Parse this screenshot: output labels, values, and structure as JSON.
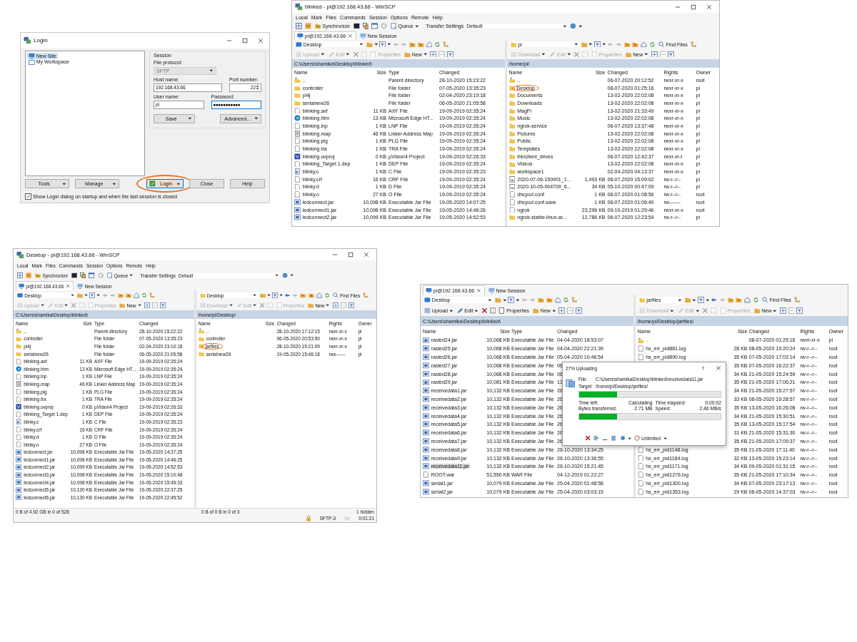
{
  "login_dialog": {
    "title": "Login",
    "sites": [
      {
        "label": "New Site",
        "kind": "site",
        "selected": true
      },
      {
        "label": "My Workspace",
        "kind": "workspace",
        "selected": false
      }
    ],
    "session": {
      "group_label": "Session",
      "protocol_label": "File protocol:",
      "protocol": "SFTP",
      "host_label": "Host name:",
      "host": "192.168.43.66",
      "port_label": "Port number:",
      "port": "22",
      "user_label": "User name:",
      "user": "pi",
      "password_label": "Password:",
      "password": "●●●●●●●●●●●"
    },
    "save": "Save",
    "advanced": "Advanced...",
    "tools": "Tools",
    "manage": "Manage",
    "login": {
      "label": "Login",
      "circled": true
    },
    "close": "Close",
    "help": "Help",
    "remember": {
      "label": "Show Login dialog on startup and when the last session is closed",
      "checked": true
    }
  },
  "windows": [
    {
      "title": "blinked - pi@192.168.43.66 - WinSCP",
      "menu": [
        "Local",
        "Mark",
        "Files",
        "Commands",
        "Session",
        "Options",
        "Remote",
        "Help"
      ],
      "toolbar": {
        "synchronize": "Synchronize",
        "queue": "Queue",
        "transfer_settings": "Transfer Settings",
        "preset": "Default"
      },
      "tabs": [
        {
          "label": "pi@192.168.43.66",
          "kind": "session",
          "selected": true
        },
        {
          "label": "New Session",
          "kind": "new",
          "selected": false
        }
      ],
      "panes": [
        {
          "location": "Desktop",
          "actions": [
            {
              "kind": "upload",
              "label": "Upload",
              "disabled": true
            },
            {
              "kind": "edit",
              "label": "Edit",
              "disabled": true
            },
            {
              "kind": "properties",
              "label": "Properties",
              "disabled": true
            },
            {
              "kind": "new",
              "label": "New",
              "disabled": false
            }
          ],
          "path": "C:\\Users\\shamika\\Desktop\\blinked\\",
          "columns": [
            "Name",
            "Size",
            "Type",
            "Changed"
          ],
          "rows": [
            {
              "kind": "parent",
              "name": "..",
              "type": "Parent directory",
              "changed": "28-10-2020 15:23:22",
              "selected": false
            },
            {
              "kind": "folder",
              "name": "controller",
              "type": "File folder",
              "changed": "07-05-2020 13:35:23",
              "selected": false
            },
            {
              "kind": "folder",
              "name": "pi4j",
              "type": "File folder",
              "changed": "02-04-2020 23:10:18",
              "selected": false
            },
            {
              "kind": "folder",
              "name": "serialnew26",
              "type": "File folder",
              "changed": "06-05-2020 21:05:58",
              "selected": false
            },
            {
              "kind": "file",
              "name": "blinking.axf",
              "size": "11 KB",
              "type": "AXF File",
              "changed": "19-09-2019 02:35:24",
              "selected": false
            },
            {
              "kind": "web",
              "name": "blinking.htm",
              "size": "13 KB",
              "type": "Microsoft Edge HT...",
              "changed": "19-09-2019 02:35:24",
              "selected": false
            },
            {
              "kind": "file",
              "name": "blinking.lnp",
              "size": "1 KB",
              "type": "LNP File",
              "changed": "19-09-2019 02:35:24",
              "selected": false
            },
            {
              "kind": "map",
              "name": "blinking.map",
              "size": "46 KB",
              "type": "Linker Address Map",
              "changed": "19-09-2019 02:35:24",
              "selected": false
            },
            {
              "kind": "file",
              "name": "blinking.plg",
              "size": "1 KB",
              "type": "PLG File",
              "changed": "19-09-2019 02:35:24",
              "selected": false
            },
            {
              "kind": "file",
              "name": "blinking.tra",
              "size": "1 KB",
              "type": "TRA File",
              "changed": "19-09-2019 02:35:24",
              "selected": false
            },
            {
              "kind": "project",
              "name": "blinking.uvproj",
              "size": "0 KB",
              "type": "µVision4 Project",
              "changed": "19-09-2019 02:26:33",
              "selected": false
            },
            {
              "kind": "file",
              "name": "blinking_Target 1.dep",
              "size": "1 KB",
              "type": "DEP File",
              "changed": "19-09-2019 02:35:24",
              "selected": false
            },
            {
              "kind": "c",
              "name": "blinky.c",
              "size": "1 KB",
              "type": "C File",
              "changed": "19-09-2019 02:35:23",
              "selected": false
            },
            {
              "kind": "file",
              "name": "blinky.crf",
              "size": "16 KB",
              "type": "CRF File",
              "changed": "19-09-2019 02:35:24",
              "selected": false
            },
            {
              "kind": "file",
              "name": "blinky.d",
              "size": "1 KB",
              "type": "D File",
              "changed": "19-09-2019 02:35:24",
              "selected": false
            },
            {
              "kind": "file",
              "name": "blinky.o",
              "size": "27 KB",
              "type": "O File",
              "changed": "19-09-2019 02:35:24",
              "selected": false
            },
            {
              "kind": "jar",
              "name": "ledconnect.jar",
              "size": "10,098 KB",
              "type": "Executable Jar File",
              "changed": "19-05-2020 14:07:25",
              "selected": false
            },
            {
              "kind": "jar",
              "name": "ledconnect1.jar",
              "size": "10,098 KB",
              "type": "Executable Jar File",
              "changed": "19-05-2020 14:46:26",
              "selected": false
            },
            {
              "kind": "jar",
              "name": "ledconnect2.jar",
              "size": "10,099 KB",
              "type": "Executable Jar File",
              "changed": "19-05-2020 14:52:53",
              "selected": false
            }
          ]
        },
        {
          "location": "pi",
          "find_files": "Find Files",
          "actions": [
            {
              "kind": "download",
              "label": "Download",
              "disabled": true
            },
            {
              "kind": "edit",
              "label": "Edit",
              "disabled": true
            },
            {
              "kind": "properties",
              "label": "Properties",
              "disabled": true
            },
            {
              "kind": "new",
              "label": "New",
              "disabled": false
            }
          ],
          "path": "/home/pi/",
          "columns": [
            "Name",
            "Size",
            "Changed",
            "Rights",
            "Owner"
          ],
          "rows": [
            {
              "kind": "parent",
              "name": "..",
              "changed": "06-07-2020 20:12:52",
              "rights": "rwxr-xr-x",
              "owner": "root",
              "selected": false
            },
            {
              "kind": "folder",
              "name": "Desktop",
              "changed": "08-07-2020 01:25:16",
              "rights": "rwxr-xr-x",
              "owner": "pi",
              "selected": false,
              "circled": true
            },
            {
              "kind": "folder",
              "name": "Documents",
              "changed": "13-02-2020 22:02:08",
              "rights": "rwxr-xr-x",
              "owner": "pi",
              "selected": false
            },
            {
              "kind": "folder",
              "name": "Downloads",
              "changed": "13-02-2020 22:02:08",
              "rights": "rwxr-xr-x",
              "owner": "pi",
              "selected": false
            },
            {
              "kind": "folder",
              "name": "MagPi",
              "changed": "13-02-2020 21:33:49",
              "rights": "rwxr-xr-x",
              "owner": "pi",
              "selected": false
            },
            {
              "kind": "folder",
              "name": "Music",
              "changed": "13-02-2020 22:02:08",
              "rights": "rwxr-xr-x",
              "owner": "pi",
              "selected": false
            },
            {
              "kind": "folder",
              "name": "ngrok-service",
              "changed": "06-07-2020 13:37:48",
              "rights": "rwxr-xr-x",
              "owner": "pi",
              "selected": false
            },
            {
              "kind": "folder",
              "name": "Pictures",
              "changed": "13-02-2020 22:02:08",
              "rights": "rwxr-xr-x",
              "owner": "pi",
              "selected": false
            },
            {
              "kind": "folder",
              "name": "Public",
              "changed": "13-02-2020 22:02:08",
              "rights": "rwxr-xr-x",
              "owner": "pi",
              "selected": false
            },
            {
              "kind": "folder",
              "name": "Templates",
              "changed": "13-02-2020 22:02:08",
              "rights": "rwxr-xr-x",
              "owner": "pi",
              "selected": false
            },
            {
              "kind": "folder",
              "name": "thinclient_drives",
              "changed": "06-07-2020 12:42:37",
              "rights": "rwxr-xr-t",
              "owner": "pi",
              "selected": false
            },
            {
              "kind": "folder",
              "name": "Videos",
              "changed": "13-02-2020 22:02:08",
              "rights": "rwxr-xr-x",
              "owner": "pi",
              "selected": false
            },
            {
              "kind": "folder",
              "name": "workspace1",
              "changed": "02-04-2020 04:13:37",
              "rights": "rwxr-xr-x",
              "owner": "pi",
              "selected": false
            },
            {
              "kind": "image",
              "name": "2020-07-06-150901_1...",
              "size": "1,493 KB",
              "changed": "06-07-2020 15:09:02",
              "rights": "rw-r--r--",
              "owner": "pi",
              "selected": false
            },
            {
              "kind": "image",
              "name": "2020-10-05-004709_6...",
              "size": "34 KB",
              "changed": "05-10-2020 00:47:09",
              "rights": "rw-r--r--",
              "owner": "pi",
              "selected": false
            },
            {
              "kind": "file",
              "name": "dhcpcd.conf",
              "size": "1 KB",
              "changed": "06-07-2020 01:08:56",
              "rights": "rw-r--r--",
              "owner": "root",
              "selected": false
            },
            {
              "kind": "file",
              "name": "dhcpcd.conf.save",
              "size": "1 KB",
              "changed": "06-07-2020 01:06:40",
              "rights": "rw-------",
              "owner": "root",
              "selected": false
            },
            {
              "kind": "file",
              "name": "ngrok",
              "size": "23,296 KB",
              "changed": "09-10-2019 01:29:46",
              "rights": "rwxr-xr-x",
              "owner": "root",
              "selected": false
            },
            {
              "kind": "folder",
              "name": "ngrok-stable-linux-ar...",
              "size": "12,786 KB",
              "changed": "06-07-2020 12:23:54",
              "rights": "rw-r--r--",
              "owner": "pi",
              "selected": false
            }
          ]
        }
      ]
    },
    {
      "title": "Desktop - pi@192.168.43.66 - WinSCP",
      "menu": [
        "Local",
        "Mark",
        "Files",
        "Commands",
        "Session",
        "Options",
        "Remote",
        "Help"
      ],
      "toolbar": {
        "synchronize": "Synchronize",
        "queue": "Queue",
        "transfer_settings": "Transfer Settings",
        "preset": "Default"
      },
      "tabs": [
        {
          "label": "pi@192.168.43.66",
          "kind": "session",
          "selected": true
        },
        {
          "label": "New Session",
          "kind": "new",
          "selected": false
        }
      ],
      "panes": [
        {
          "location": "Desktop",
          "actions": [
            {
              "kind": "upload",
              "label": "Upload",
              "disabled": true
            },
            {
              "kind": "edit",
              "label": "Edit",
              "disabled": true
            },
            {
              "kind": "properties",
              "label": "Properties",
              "disabled": true
            },
            {
              "kind": "new",
              "label": "New",
              "disabled": false
            }
          ],
          "path": "C:\\Users\\shamika\\Desktop\\blinked\\",
          "columns": [
            "Name",
            "Size",
            "Type",
            "Changed"
          ],
          "rows": [
            {
              "kind": "parent",
              "name": "..",
              "type": "Parent directory",
              "changed": "28-10-2020 15:22:22",
              "selected": false
            },
            {
              "kind": "folder",
              "name": "controller",
              "type": "File folder",
              "changed": "07-05-2020 13:35:23",
              "selected": false
            },
            {
              "kind": "folder",
              "name": "pi4j",
              "type": "File folder",
              "changed": "02-04-2020 23:10:18",
              "selected": false
            },
            {
              "kind": "folder",
              "name": "serialnew26",
              "type": "File folder",
              "changed": "06-05-2020 21:05:58",
              "selected": false
            },
            {
              "kind": "file",
              "name": "blinking.axf",
              "size": "11 KB",
              "type": "AXF File",
              "changed": "19-09-2019 02:35:24",
              "selected": false
            },
            {
              "kind": "web",
              "name": "blinking.htm",
              "size": "13 KB",
              "type": "Microsoft Edge HT...",
              "changed": "19-09-2019 02:35:24",
              "selected": false
            },
            {
              "kind": "file",
              "name": "blinking.lnp",
              "size": "1 KB",
              "type": "LNP File",
              "changed": "19-09-2019 02:35:24",
              "selected": false
            },
            {
              "kind": "map",
              "name": "blinking.map",
              "size": "46 KB",
              "type": "Linker Address Map",
              "changed": "19-09-2019 02:35:24",
              "selected": false
            },
            {
              "kind": "file",
              "name": "blinking.plg",
              "size": "1 KB",
              "type": "PLG File",
              "changed": "19-09-2019 02:35:24",
              "selected": false
            },
            {
              "kind": "file",
              "name": "blinking.tra",
              "size": "1 KB",
              "type": "TRA File",
              "changed": "19-09-2019 02:35:24",
              "selected": false
            },
            {
              "kind": "project",
              "name": "blinking.uvproj",
              "size": "0 KB",
              "type": "µVision4 Project",
              "changed": "19-09-2019 02:26:33",
              "selected": false
            },
            {
              "kind": "file",
              "name": "blinking_Target 1.dep",
              "size": "1 KB",
              "type": "DEP File",
              "changed": "19-09-2019 02:35:24",
              "selected": false
            },
            {
              "kind": "c",
              "name": "blinky.c",
              "size": "1 KB",
              "type": "C File",
              "changed": "19-09-2019 02:35:23",
              "selected": false
            },
            {
              "kind": "file",
              "name": "blinky.crf",
              "size": "16 KB",
              "type": "CRF File",
              "changed": "19-09-2019 02:35:24",
              "selected": false
            },
            {
              "kind": "file",
              "name": "blinky.d",
              "size": "1 KB",
              "type": "D File",
              "changed": "19-09-2019 02:35:24",
              "selected": false
            },
            {
              "kind": "file",
              "name": "blinky.o",
              "size": "27 KB",
              "type": "O File",
              "changed": "19-09-2019 02:35:24",
              "selected": false
            },
            {
              "kind": "jar",
              "name": "ledconnect.jar",
              "size": "10,098 KB",
              "type": "Executable Jar File",
              "changed": "19-05-2020 14:37:25",
              "selected": false
            },
            {
              "kind": "jar",
              "name": "ledconnect1.jar",
              "size": "10,098 KB",
              "type": "Executable Jar File",
              "changed": "19-05-2020 14:46:25",
              "selected": false
            },
            {
              "kind": "jar",
              "name": "ledconnect2.jar",
              "size": "10,099 KB",
              "type": "Executable Jar File",
              "changed": "19-05-2020 14:52:53",
              "selected": false
            },
            {
              "kind": "jar",
              "name": "ledconnect3.jar",
              "size": "10,098 KB",
              "type": "Executable Jar File",
              "changed": "19-05-2020 15:10:48",
              "selected": false
            },
            {
              "kind": "jar",
              "name": "ledconnect4.jar",
              "size": "10,098 KB",
              "type": "Executable Jar File",
              "changed": "19-05-2020 15:45:33",
              "selected": false
            },
            {
              "kind": "jar",
              "name": "ledconnect5.jar",
              "size": "10,130 KB",
              "type": "Executable Jar File",
              "changed": "19-05-2020 22:37:25",
              "selected": false
            },
            {
              "kind": "jar",
              "name": "ledconnect6.jar",
              "size": "10,130 KB",
              "type": "Executable Jar File",
              "changed": "19-05-2020 22:45:52",
              "selected": false
            }
          ]
        },
        {
          "location": "Desktop",
          "find_files": "Find Files",
          "actions": [
            {
              "kind": "download",
              "label": "Download",
              "disabled": true
            },
            {
              "kind": "edit",
              "label": "Edit",
              "disabled": true
            },
            {
              "kind": "properties",
              "label": "Properties",
              "disabled": true
            },
            {
              "kind": "new",
              "label": "New",
              "disabled": false
            }
          ],
          "path": "/home/pi/Desktop/",
          "columns": [
            "Name",
            "Size",
            "Changed",
            "Rights",
            "Owner"
          ],
          "rows": [
            {
              "kind": "parent",
              "name": "..",
              "changed": "28-10-2020 17:12:15",
              "rights": "rwxr-xr-x",
              "owner": "pi",
              "selected": false
            },
            {
              "kind": "folder",
              "name": "controller",
              "changed": "06-05-2020 20:53:50",
              "rights": "rwxr-xr-x",
              "owner": "pi",
              "selected": false
            },
            {
              "kind": "folder",
              "name": "jarfiles",
              "changed": "28-10-2020 15:21:09",
              "rights": "rwxr-xr-x",
              "owner": "pi",
              "selected": false,
              "circled": true
            },
            {
              "kind": "folder",
              "name": "serialnew26",
              "changed": "19-05-2020 15:46:18",
              "rights": "rwx------",
              "owner": "pi",
              "selected": false
            }
          ]
        }
      ],
      "status": {
        "left": "0 B of 4.92 GB in 0 of 528",
        "right": "0 B of 0 B in 0 of 3",
        "hidden": "1 hidden",
        "protocol": "SFTP-3",
        "time": "0:01:21"
      }
    },
    {
      "tabs": [
        {
          "label": "pi@192.168.43.66",
          "kind": "session",
          "selected": true
        },
        {
          "label": "New Session",
          "kind": "new",
          "selected": false
        }
      ],
      "panes": [
        {
          "location": "Desktop",
          "actions": [
            {
              "kind": "upload",
              "label": "Upload",
              "disabled": false
            },
            {
              "kind": "edit",
              "label": "Edit",
              "disabled": false
            },
            {
              "kind": "properties",
              "label": "Properties",
              "disabled": false
            },
            {
              "kind": "new",
              "label": "New",
              "disabled": false
            }
          ],
          "path": "C:\\Users\\shamika\\Desktop\\blinked\\",
          "columns": [
            "Name",
            "Size",
            "Type",
            "Changed"
          ],
          "rows": [
            {
              "kind": "jar",
              "name": "rasled24.jar",
              "size": "10,068 KB",
              "type": "Executable Jar File",
              "changed": "04-04-2020 18:53:07",
              "selected": false
            },
            {
              "kind": "jar",
              "name": "rasled25.jar",
              "size": "10,068 KB",
              "type": "Executable Jar File",
              "changed": "04-04-2020 22:21:39",
              "selected": false
            },
            {
              "kind": "jar",
              "name": "rasled26.jar",
              "size": "10,068 KB",
              "type": "Executable Jar File",
              "changed": "05-04-2020 10:46:54",
              "selected": false
            },
            {
              "kind": "jar",
              "name": "rasled27.jar",
              "size": "10,068 KB",
              "type": "Executable Jar File",
              "changed": "06",
              "selected": false
            },
            {
              "kind": "jar",
              "name": "rasled28.jar",
              "size": "10,068 KB",
              "type": "Executable Jar File",
              "changed": "06",
              "selected": false
            },
            {
              "kind": "jar",
              "name": "rasled29.jar",
              "size": "10,081 KB",
              "type": "Executable Jar File",
              "changed": "13",
              "selected": false
            },
            {
              "kind": "jar",
              "name": "receivedata1.jar",
              "size": "10,132 KB",
              "type": "Executable Jar File",
              "changed": "26",
              "selected": false
            },
            {
              "kind": "jar",
              "name": "receivedata2.jar",
              "size": "10,132 KB",
              "type": "Executable Jar File",
              "changed": "26",
              "selected": false
            },
            {
              "kind": "jar",
              "name": "receivedata3.jar",
              "size": "10,132 KB",
              "type": "Executable Jar File",
              "changed": "26",
              "selected": false
            },
            {
              "kind": "jar",
              "name": "receivedata4.jar",
              "size": "10,132 KB",
              "type": "Executable Jar File",
              "changed": "26",
              "selected": false
            },
            {
              "kind": "jar",
              "name": "receivedata5.jar",
              "size": "10,132 KB",
              "type": "Executable Jar File",
              "changed": "26",
              "selected": false
            },
            {
              "kind": "jar",
              "name": "receivedata6.jar",
              "size": "10,132 KB",
              "type": "Executable Jar File",
              "changed": "26",
              "selected": false
            },
            {
              "kind": "jar",
              "name": "receivedata7.jar",
              "size": "10,132 KB",
              "type": "Executable Jar File",
              "changed": "26",
              "selected": false
            },
            {
              "kind": "jar",
              "name": "receivedata8.jar",
              "size": "10,132 KB",
              "type": "Executable Jar File",
              "changed": "26-10-2020 13:34:25",
              "selected": false
            },
            {
              "kind": "jar",
              "name": "receivedata9.jar",
              "size": "10,132 KB",
              "type": "Executable Jar File",
              "changed": "26-10-2020 13:36:55",
              "selected": false
            },
            {
              "kind": "jar",
              "name": "receivedata11.jar",
              "size": "10,132 KB",
              "type": "Executable Jar File",
              "changed": "26-10-2020 15:21:45",
              "selected": true
            },
            {
              "kind": "file",
              "name": "ROOT.war",
              "size": "51,550 KB",
              "type": "WAR File",
              "changed": "04-12-2019 01:22:27",
              "selected": false
            },
            {
              "kind": "jar",
              "name": "serial1.jar",
              "size": "10,079 KB",
              "type": "Executable Jar File",
              "changed": "25-04-2020 01:48:58",
              "selected": false
            },
            {
              "kind": "jar",
              "name": "serial2.jar",
              "size": "10,079 KB",
              "type": "Executable Jar File",
              "changed": "25-04-2020 03:03:15",
              "selected": false
            }
          ]
        },
        {
          "location": "jarfiles",
          "find_files": "Find Files",
          "actions": [
            {
              "kind": "download",
              "label": "Download",
              "disabled": true
            },
            {
              "kind": "edit",
              "label": "Edit",
              "disabled": true
            },
            {
              "kind": "properties",
              "label": "Properties",
              "disabled": true
            },
            {
              "kind": "new",
              "label": "New",
              "disabled": false
            }
          ],
          "path": "/home/pi/Desktop/jarfiles/",
          "columns": [
            "Name",
            "Size",
            "Changed",
            "Rights",
            "Owner"
          ],
          "rows": [
            {
              "kind": "parent",
              "name": "..",
              "changed": "08-07-2020 01:25:16",
              "rights": "rwxr-xr-x",
              "owner": "pi",
              "selected": false
            },
            {
              "kind": "file",
              "name": "hs_err_pid881.log",
              "size": "28 KB",
              "changed": "08-05-2020 19:20:24",
              "rights": "rw-r--r--",
              "owner": "root",
              "selected": false
            },
            {
              "kind": "file",
              "name": "hs_err_pid890.log",
              "size": "35 KB",
              "changed": "07-05-2020 17:02:14",
              "rights": "rw-r--r--",
              "owner": "root",
              "selected": false
            },
            {
              "size": "35 KB",
              "changed": "07-05-2020 16:22:37",
              "rights": "rw-r--r--",
              "owner": "root"
            },
            {
              "size": "34 KB",
              "changed": "21-05-2020 15:24:59",
              "rights": "rw-r--r--",
              "owner": "root"
            },
            {
              "size": "35 KB",
              "changed": "21-05-2020 17:06:21",
              "rights": "rw-r--r--",
              "owner": "root"
            },
            {
              "size": "34 KB",
              "changed": "21-05-2020 15:27:57",
              "rights": "rw-r--r--",
              "owner": "root"
            },
            {
              "size": "33 KB",
              "changed": "08-05-2020 19:28:57",
              "rights": "rw-r--r--",
              "owner": "root"
            },
            {
              "size": "35 KB",
              "changed": "13-05-2020 16:26:08",
              "rights": "rw-r--r--",
              "owner": "root"
            },
            {
              "size": "34 KB",
              "changed": "21-05-2020 15:30:51",
              "rights": "rw-r--r--",
              "owner": "root"
            },
            {
              "size": "35 KB",
              "changed": "13-05-2020 15:17:54",
              "rights": "rw-r--r--",
              "owner": "root"
            },
            {
              "size": "31 KB",
              "changed": "21-05-2020 15:31:30",
              "rights": "rw-r--r--",
              "owner": "root"
            },
            {
              "size": "35 KB",
              "changed": "21-05-2020 17:09:37",
              "rights": "rw-r--r--",
              "owner": "root"
            },
            {
              "kind": "file",
              "name": "hs_err_pid1148.log",
              "size": "35 KB",
              "changed": "21-05-2020 17:11:40",
              "rights": "rw-r--r--",
              "owner": "root",
              "selected": false
            },
            {
              "kind": "file",
              "name": "hs_err_pid1164.log",
              "size": "32 KB",
              "changed": "13-05-2020 15:23:14",
              "rights": "rw-r--r--",
              "owner": "root",
              "selected": false
            },
            {
              "kind": "file",
              "name": "hs_err_pid1171.log",
              "size": "34 KB",
              "changed": "09-05-2020 01:31:15",
              "rights": "rw-r--r--",
              "owner": "root",
              "selected": false
            },
            {
              "kind": "file",
              "name": "hs_err_pid1276.log",
              "size": "35 KB",
              "changed": "21-05-2020 17:10:34",
              "rights": "rw-r--r--",
              "owner": "root",
              "selected": false
            },
            {
              "kind": "file",
              "name": "hs_err_pid1300.log",
              "size": "34 KB",
              "changed": "07-05-2020 23:17:13",
              "rights": "rw-r--r--",
              "owner": "root",
              "selected": false
            },
            {
              "kind": "file",
              "name": "hs_err_pid1353.log",
              "size": "29 KB",
              "changed": "06-05-2020 14:37:03",
              "rights": "rw-r--r--",
              "owner": "root",
              "selected": false
            }
          ]
        }
      ],
      "upload_dialog": {
        "title": "27% Uploading",
        "help": "?",
        "file_label": "File:",
        "file": "C:\\Users\\shamika\\Desktop\\blinked\\receivedata11.jar",
        "target_label": "Target:",
        "target": "/home/pi/Desktop/jarfiles/",
        "file_progress": {
          "level": 0.27
        },
        "stats": [
          {
            "label": "Time left:",
            "value": "Calculating"
          },
          {
            "label": "Time elapsed:",
            "value": "0:00:02"
          },
          {
            "label": "Bytes transferred:",
            "value": "2.71 MB"
          },
          {
            "label": "Speed:",
            "value": "2.46 MB/s"
          }
        ],
        "total_progress": {
          "level": 0.27
        },
        "speed_limit": "Unlimited"
      }
    }
  ]
}
